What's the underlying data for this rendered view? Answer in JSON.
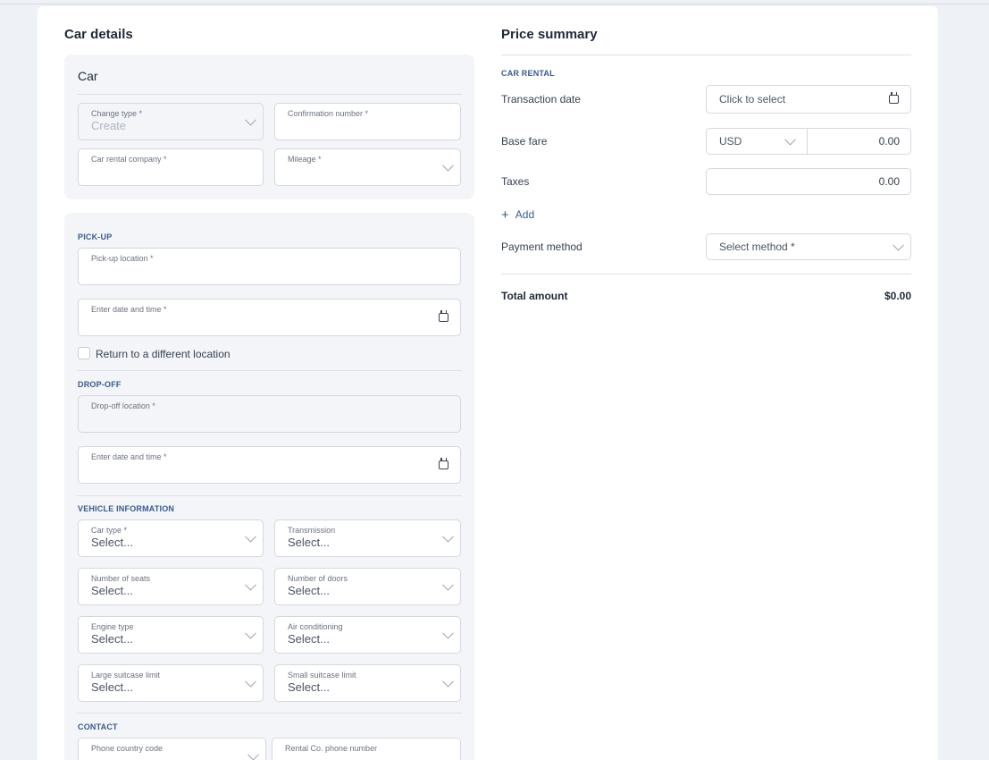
{
  "car_details": {
    "title": "Car details",
    "car_panel": {
      "title": "Car",
      "change_type": {
        "label": "Change type *",
        "value": "Create"
      },
      "confirmation_number": {
        "label": "Confirmation number *",
        "value": ""
      },
      "car_rental_company": {
        "label": "Car rental company *",
        "value": ""
      },
      "mileage": {
        "label": "Mileage *",
        "value": ""
      }
    },
    "pickup": {
      "section": "PICK-UP",
      "location": {
        "label": "Pick-up location *",
        "value": ""
      },
      "datetime": {
        "label": "Enter date and time *",
        "value": ""
      },
      "return_different": {
        "label": "Return to a different location",
        "checked": false
      }
    },
    "dropoff": {
      "section": "DROP-OFF",
      "location": {
        "label": "Drop-off location *",
        "value": ""
      },
      "datetime": {
        "label": "Enter date and time *",
        "value": ""
      }
    },
    "vehicle": {
      "section": "VEHICLE INFORMATION",
      "car_type": {
        "label": "Car type *",
        "value": "Select..."
      },
      "transmission": {
        "label": "Transmission",
        "value": "Select..."
      },
      "seats": {
        "label": "Number of seats",
        "value": "Select..."
      },
      "doors": {
        "label": "Number of doors",
        "value": "Select..."
      },
      "engine": {
        "label": "Engine type",
        "value": "Select..."
      },
      "air": {
        "label": "Air conditioning",
        "value": "Select..."
      },
      "large_suitcase": {
        "label": "Large suitcase limit",
        "value": "Select..."
      },
      "small_suitcase": {
        "label": "Small suitcase limit",
        "value": "Select..."
      }
    },
    "contact": {
      "section": "CONTACT",
      "phone_country": {
        "label": "Phone country code",
        "value": ""
      },
      "rental_phone": {
        "label": "Rental Co. phone number",
        "value": ""
      }
    }
  },
  "price_summary": {
    "title": "Price summary",
    "section": "CAR RENTAL",
    "transaction_date": {
      "label": "Transaction date",
      "placeholder": "Click to select"
    },
    "base_fare": {
      "label": "Base fare",
      "currency": "USD",
      "amount": "0.00"
    },
    "taxes": {
      "label": "Taxes",
      "amount": "0.00"
    },
    "add_label": "Add",
    "payment_method": {
      "label": "Payment method",
      "placeholder": "Select method *"
    },
    "total": {
      "label": "Total amount",
      "value": "$0.00"
    }
  }
}
